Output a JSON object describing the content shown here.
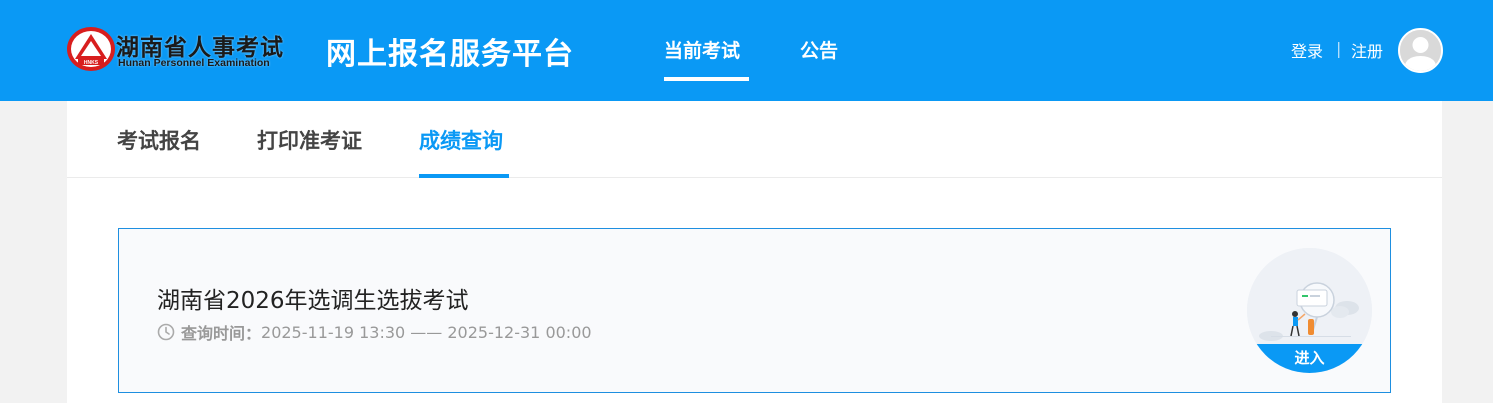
{
  "header": {
    "logo_cn": "湖南省人事考试",
    "logo_en": "Hunan Personnel Examination",
    "logo_badge": "HNKS",
    "site_title": "网上报名服务平台",
    "nav": [
      {
        "label": "当前考试",
        "active": true
      },
      {
        "label": "公告",
        "active": false
      }
    ],
    "login_label": "登录",
    "separator": "|",
    "register_label": "注册",
    "avatar_icon": "user-avatar-icon"
  },
  "subtabs": [
    {
      "label": "考试报名",
      "active": false
    },
    {
      "label": "打印准考证",
      "active": false
    },
    {
      "label": "成绩查询",
      "active": true
    }
  ],
  "exam": {
    "title": "湖南省2026年选调生选拔考试",
    "time_label": "查询时间：",
    "time_value": "2025-11-19 13:30 —— 2025-12-31 00:00",
    "time_icon": "clock-icon",
    "enter_label": "进入"
  },
  "colors": {
    "brand": "#0a99f5",
    "card_border": "#1e8fe0",
    "page_bg": "#f2f2f2"
  }
}
